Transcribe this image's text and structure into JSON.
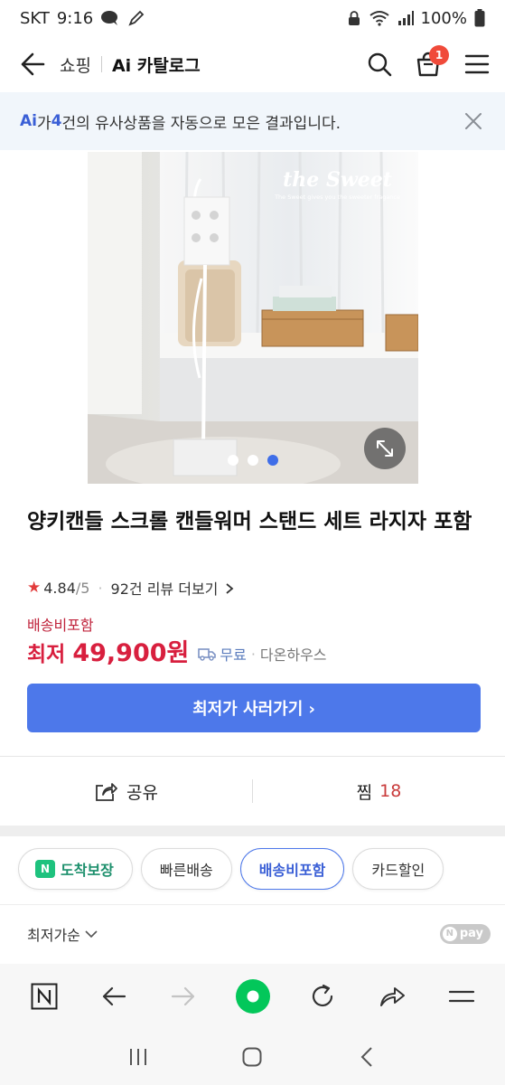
{
  "status_bar": {
    "carrier": "SKT",
    "time": "9:16",
    "battery": "100%"
  },
  "header": {
    "breadcrumb_shop": "쇼핑",
    "title": "Ai 카탈로그",
    "cart_count": "1"
  },
  "ai_notice": {
    "logo": "Ai",
    "text_prefix": "가 ",
    "count": "4",
    "text_suffix": "건의 유사상품을 자동으로 모은 결과입니다."
  },
  "product_image": {
    "watermark_brand": "the Sweet",
    "watermark_tagline": "The Sweet gives you the sweeter fragance",
    "active_slide": 3,
    "slide_count": 3
  },
  "product": {
    "title": "양키캔들 스크롤 캔들워머 스탠드 세트 라지자 포함",
    "rating": "4.84",
    "rating_out_of": "/5",
    "review_text": "92건 리뷰 더보기",
    "shipping_label": "배송비포함",
    "price_prefix": "최저",
    "price": "49,900원",
    "delivery_fee": "무료",
    "seller": "다온하우스"
  },
  "buy_button": {
    "label": "최저가 사러가기 ›"
  },
  "actions": {
    "share_label": "공유",
    "zzim_label": "찜",
    "zzim_count": "18"
  },
  "filters": [
    {
      "label": "도착보장",
      "badge": "N"
    },
    {
      "label": "빠른배송"
    },
    {
      "label": "배송비포함"
    },
    {
      "label": "카드할인"
    }
  ],
  "sort": {
    "selected": "최저가순",
    "npay": "pay"
  },
  "colors": {
    "accent": "#4d78ea",
    "price_red": "#d81f3e",
    "badge_red": "#f04a3a",
    "green": "#1ec27e"
  },
  "icons": {
    "back": "arrow-left-icon",
    "search": "search-icon",
    "cart": "shopping-bag-icon",
    "menu": "hamburger-menu-icon",
    "close": "close-icon",
    "expand": "expand-icon",
    "share": "share-icon",
    "truck": "truck-icon"
  }
}
